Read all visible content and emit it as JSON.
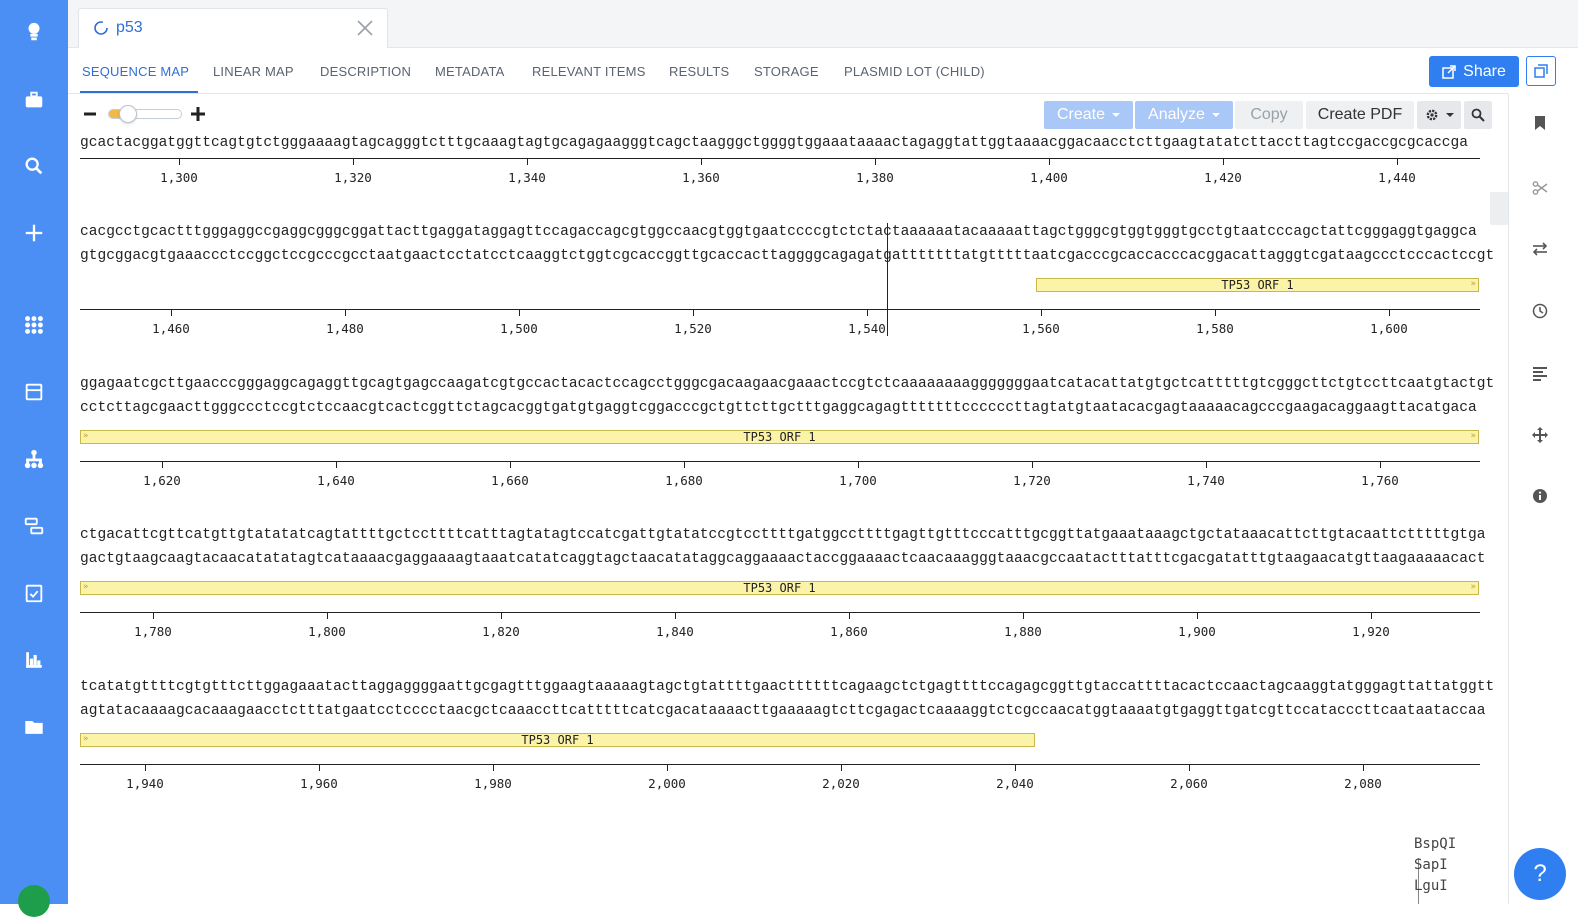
{
  "tab": {
    "title": "p53"
  },
  "subtabs": [
    "SEQUENCE MAP",
    "LINEAR MAP",
    "DESCRIPTION",
    "METADATA",
    "RELEVANT ITEMS",
    "RESULTS",
    "STORAGE",
    "PLASMID LOT (CHILD)"
  ],
  "share_label": "Share",
  "toolbar": {
    "create_label": "Create",
    "analyze_label": "Analyze",
    "copy_label": "Copy",
    "pdf_label": "Create PDF",
    "zoom_level": 0.2
  },
  "sequence": {
    "rows": [
      {
        "top": "gcactacggatggttcagtgtctgggaaaagtagcagggtctttgcaaagtagtgcagagaagggtcagctaagggctggggtggaaataaaactagaggtattggtaaaacggacaacctcttgaagtatatcttaccttagtccgaccgcgcaccga",
        "bottom": "",
        "ticks": [
          "1,300",
          "1,320",
          "1,340",
          "1,360",
          "1,380",
          "1,400",
          "1,420",
          "1,440"
        ],
        "feature": null
      },
      {
        "top": "cacgcctgcactttgggaggccgaggcgggcggattacttgaggataggagttccagaccagcgtggccaacgtggtgaatccccgtctctactaaaaaatacaaaaattagctgggcgtggtgggtgcctgtaatcccagctattcgggaggtgaggca",
        "bottom": "gtgcggacgtgaaaccctccggctccgcccgcctaatgaactcctatcctcaaggtctggtcgcaccggttgcaccacttaggggcagagatgatttttttatgtttttaatcgacccgcaccacccacggacattagggtcgataagccctcccactccgt",
        "ticks": [
          "1,460",
          "1,480",
          "1,500",
          "1,520",
          "1,540",
          "1,560",
          "1,580",
          "1,600"
        ],
        "feature": "TP53 ORF 1"
      },
      {
        "top": "ggagaatcgcttgaacccgggaggcagaggttgcagtgagccaagatcgtgccactacactccagcctgggcgacaagaacgaaactccgtctcaaaaaaaagggggggaatcatacattatgtgctcatttttgtcgggcttctgtccttcaatgtactgt",
        "bottom": "cctcttagcgaacttgggccctccgtctccaacgtcactcggttctagcacggtgatgtgaggtcggacccgctgttcttgctttgaggcagagtttttttccccccttagtatgtaatacacgagtaaaaacagcccgaagacaggaagttacatgaca",
        "ticks": [
          "1,620",
          "1,640",
          "1,660",
          "1,680",
          "1,700",
          "1,720",
          "1,740",
          "1,760"
        ],
        "feature": "TP53 ORF 1"
      },
      {
        "top": "ctgacattcgttcatgttgtatatatcagtattttgctccttttcatttagtatagtccatcgattgtatatccgtccttttgatggccttttgagttgtttcccatttgcggttatgaaataaagctgctataaacattcttgtacaattctttttgtga",
        "bottom": "gactgtaagcaagtacaacatatatagtcataaaacgaggaaaagtaaatcatatcaggtagctaacatataggcaggaaaactaccggaaaactcaacaaagggtaaacgccaatactttatttcgacgatatttgtaagaacatgttaagaaaaacact",
        "ticks": [
          "1,780",
          "1,800",
          "1,820",
          "1,840",
          "1,860",
          "1,880",
          "1,900",
          "1,920"
        ],
        "feature": "TP53 ORF 1"
      },
      {
        "top": "tcatatgttttcgtgtttcttggagaaatacttaggaggggaattgcgagtttggaagtaaaaagtagctgtattttgaacttttttcagaagctctgagttttccagagcggttgtaccattttacactccaactagcaaggtatgggagttattatggtt",
        "bottom": "agtatacaaaagcacaaagaacctctttatgaatcctcccctaacgctcaaaccttcatttttcatcgacataaaacttgaaaaagtcttcgagactcaaaaggtctcgccaacatggtaaaatgtgaggttgatcgttccatacccttcaataataccaa",
        "ticks": [
          "1,940",
          "1,960",
          "1,980",
          "2,000",
          "2,020",
          "2,040",
          "2,060",
          "2,080"
        ],
        "feature": "TP53 ORF 1"
      }
    ]
  },
  "enzymes": [
    "BspQI",
    "SapI",
    "LguI"
  ],
  "colors": {
    "nav": "#4b8ff5",
    "accent": "#2f7ff0",
    "feature": "#fbf3a8"
  }
}
